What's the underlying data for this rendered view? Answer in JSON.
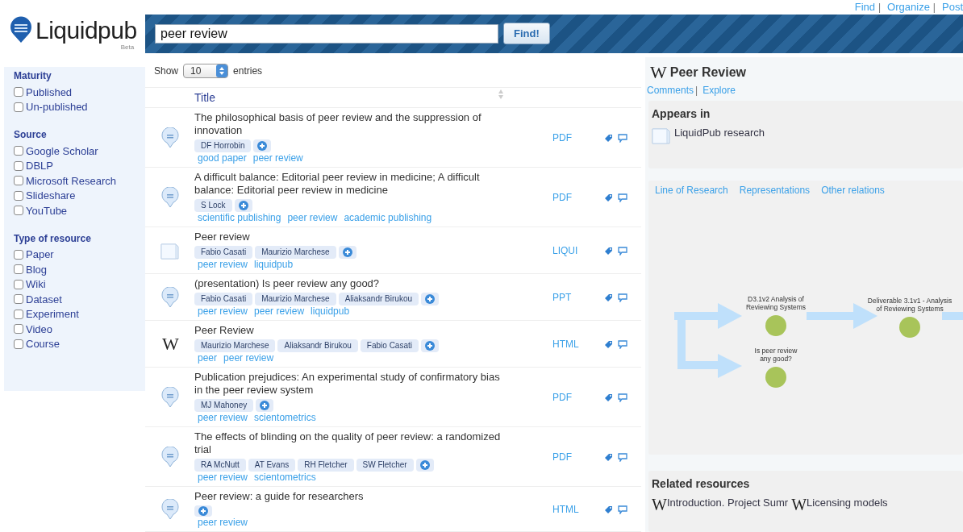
{
  "top_links": {
    "items": [
      "Find",
      "Organize",
      "Post"
    ],
    "separator": "|"
  },
  "logo": {
    "name": "Liquidpub",
    "badge": "Beta"
  },
  "search": {
    "value": "peer review",
    "button": "Find!"
  },
  "filters": [
    {
      "heading": "Maturity",
      "options": [
        {
          "label": "Published",
          "checked": false
        },
        {
          "label": "Un-published",
          "checked": false
        }
      ]
    },
    {
      "heading": "Source",
      "options": [
        {
          "label": "Google Scholar",
          "checked": false
        },
        {
          "label": "DBLP",
          "checked": false
        },
        {
          "label": "Microsoft Research",
          "checked": false
        },
        {
          "label": "Slideshare",
          "checked": false
        },
        {
          "label": "YouTube",
          "checked": false
        }
      ]
    },
    {
      "heading": "Type of resource",
      "options": [
        {
          "label": "Paper",
          "checked": false
        },
        {
          "label": "Blog",
          "checked": false
        },
        {
          "label": "Wiki",
          "checked": false
        },
        {
          "label": "Dataset",
          "checked": false
        },
        {
          "label": "Experiment",
          "checked": false
        },
        {
          "label": "Video",
          "checked": false
        },
        {
          "label": "Course",
          "checked": false
        }
      ]
    }
  ],
  "list": {
    "show_label": "Show",
    "page_size": "10",
    "entries_label": "entries",
    "columns": [
      "Title"
    ],
    "rows": [
      {
        "kind": "doc",
        "title": "The philosophical basis of peer review and the suppression of innovation",
        "authors": [
          "DF Horrobin"
        ],
        "tags": [
          "good paper",
          "peer review"
        ],
        "format": "PDF"
      },
      {
        "kind": "doc",
        "title": "A difficult balance: Editorial peer review in medicine; A difficult balance: Editorial peer review in medicine",
        "authors": [
          "S Lock"
        ],
        "tags": [
          "scientific publishing",
          "peer review",
          "academic publishing"
        ],
        "format": "PDF"
      },
      {
        "kind": "folder",
        "title": "Peer review",
        "authors": [
          "Fabio Casati",
          "Maurizio Marchese"
        ],
        "tags": [
          "peer review",
          "liquidpub"
        ],
        "format": "LIQUI"
      },
      {
        "kind": "doc",
        "title": "(presentation) Is peer review any good?",
        "authors": [
          "Fabio Casati",
          "Maurizio Marchese",
          "Aliaksandr Birukou"
        ],
        "tags": [
          "peer review",
          "peer review",
          "liquidpub"
        ],
        "format": "PPT"
      },
      {
        "kind": "wiki",
        "icon_text": "W",
        "title": "Peer Review",
        "authors": [
          "Maurizio Marchese",
          "Aliaksandr Birukou",
          "Fabio Casati"
        ],
        "tags": [
          "peer",
          "peer review"
        ],
        "format": "HTML"
      },
      {
        "kind": "doc",
        "title": "Publication prejudices: An experimental study of confirmatory bias in the peer review system",
        "authors": [
          "MJ Mahoney"
        ],
        "tags": [
          "peer review",
          "scientometrics"
        ],
        "format": "PDF"
      },
      {
        "kind": "doc",
        "title": "The effects of blinding on the quality of peer review: a randomized trial",
        "authors": [
          "RA McNutt",
          "AT Evans",
          "RH Fletcher",
          "SW Fletcher"
        ],
        "tags": [
          "peer review",
          "scientometrics"
        ],
        "format": "PDF"
      },
      {
        "kind": "doc",
        "title": "Peer review: a guide for researchers",
        "authors": [],
        "tags": [
          "peer review"
        ],
        "format": "HTML"
      }
    ]
  },
  "detail": {
    "icon_text": "W",
    "title": "Peer Review",
    "links": [
      "Comments",
      "Explore"
    ],
    "separator": "|",
    "appears_in": {
      "heading": "Appears in",
      "items": [
        "LiquidPub research"
      ]
    },
    "graph": {
      "tabs": [
        "Line of Research",
        "Representations",
        "Other relations"
      ],
      "nodes": [
        {
          "label": "D3.1v2 Analysis of Reviewing Systems"
        },
        {
          "label": "Deliverable 3.1v1 - Analysis of Reviewing Systems"
        },
        {
          "label": "Is peer review any good?"
        }
      ]
    },
    "related": {
      "heading": "Related resources",
      "items": [
        {
          "icon_text": "W",
          "label": "Introduction. Project Sumr"
        },
        {
          "icon_text": "W",
          "label": "Licensing models"
        }
      ]
    }
  }
}
